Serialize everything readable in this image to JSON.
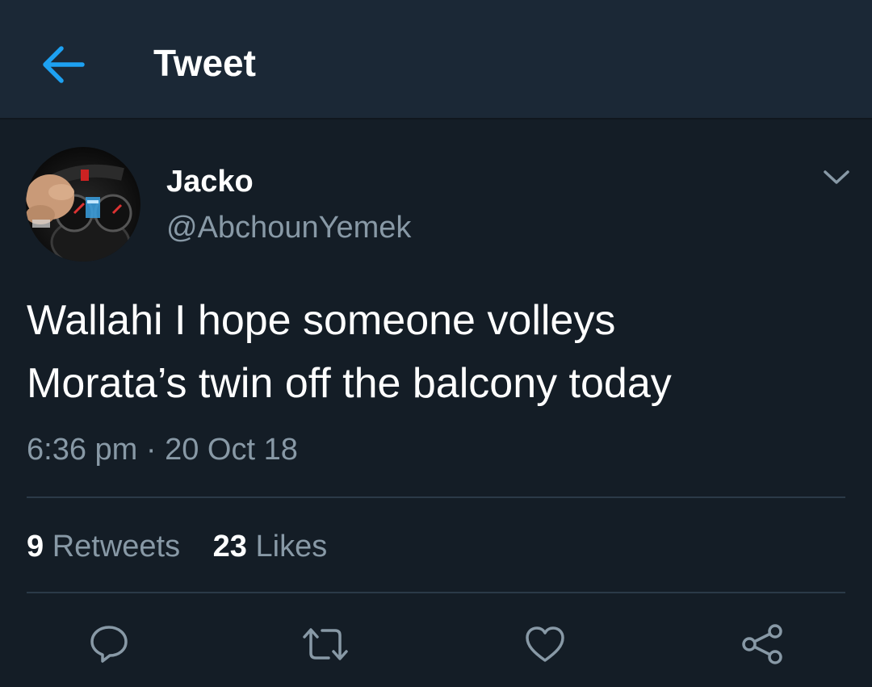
{
  "header": {
    "title": "Tweet",
    "back_icon": "back-arrow-icon"
  },
  "tweet": {
    "author": {
      "name": "Jacko",
      "handle": "@AbchounYemek",
      "avatar": "avatar-steering-wheel-photo"
    },
    "text_lines": [
      "Wallahi I hope someone volleys",
      "Morata’s twin off the balcony today"
    ],
    "time": "6:36 pm",
    "separator": "·",
    "date": "20 Oct 18",
    "stats": {
      "retweets_count": "9",
      "retweets_label": "Retweets",
      "likes_count": "23",
      "likes_label": "Likes"
    }
  },
  "actions": [
    {
      "icon": "reply-icon"
    },
    {
      "icon": "retweet-icon"
    },
    {
      "icon": "like-heart-icon"
    },
    {
      "icon": "share-icon"
    }
  ],
  "colors": {
    "background": "#141d26",
    "header_background": "#1b2836",
    "accent": "#1da1f2",
    "secondary_text": "#8899a6",
    "primary_text": "#ffffff",
    "divider": "#2b3a48"
  }
}
